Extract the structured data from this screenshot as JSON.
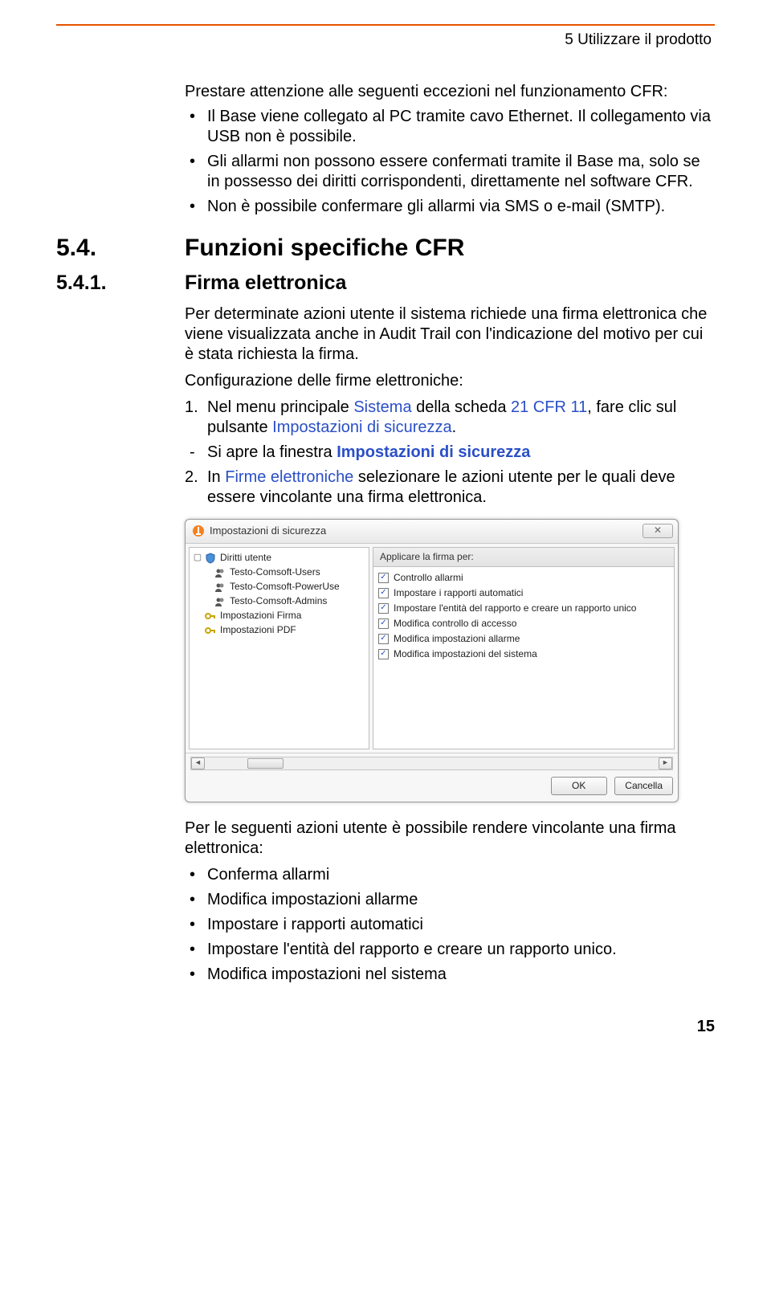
{
  "header": {
    "right": "5 Utilizzare il prodotto"
  },
  "intro": {
    "lead": "Prestare attenzione alle seguenti eccezioni nel funzionamento CFR:",
    "bullets": [
      "Il Base viene collegato al PC tramite cavo Ethernet. Il collegamento via USB non è possibile.",
      "Gli allarmi non possono essere confermati tramite il Base ma, solo se in possesso dei diritti corrispondenti, direttamente nel software CFR.",
      "Non è possibile confermare gli allarmi via SMS o e-mail (SMTP)."
    ]
  },
  "sec54": {
    "num": "5.4.",
    "title": "Funzioni specifiche CFR"
  },
  "sec541": {
    "num": "5.4.1.",
    "title": "Firma elettronica",
    "para1": "Per determinate azioni utente il sistema richiede una firma elettronica che viene visualizzata anche in Audit Trail con l'indicazione del motivo per cui è stata richiesta la firma.",
    "para2": "Configurazione delle firme elettroniche:",
    "step1_pre": "Nel menu principale ",
    "step1_sistema": "Sistema",
    "step1_mid": " della scheda ",
    "step1_cfr": "21 CFR 11",
    "step1_mid2": ", fare clic sul pulsante ",
    "step1_imp": "Impostazioni di sicurezza",
    "step1_end": ".",
    "dash_pre": "Si apre la finestra ",
    "dash_bold": "Impostazioni di sicurezza",
    "step2_pre": "In ",
    "step2_bold": "Firme elettroniche",
    "step2_rest": " selezionare le azioni utente per le quali deve essere vincolante una firma elettronica."
  },
  "dialog": {
    "title": "Impostazioni di sicurezza",
    "close": "✕",
    "tree": {
      "root": "Diritti utente",
      "children": [
        "Testo-Comsoft-Users",
        "Testo-Comsoft-PowerUse",
        "Testo-Comsoft-Admins"
      ],
      "extra": [
        "Impostazioni Firma",
        "Impostazioni PDF"
      ]
    },
    "right_header": "Applicare la firma per:",
    "checks": [
      "Controllo allarmi",
      "Impostare i rapporti automatici",
      "Impostare l'entità del rapporto e creare un rapporto unico",
      "Modifica controllo di accesso",
      "Modifica impostazioni allarme",
      "Modifica impostazioni del sistema"
    ],
    "ok": "OK",
    "cancel": "Cancella"
  },
  "after": {
    "lead": "Per le seguenti azioni utente è possibile rendere vincolante una firma elettronica:",
    "bullets": [
      "Conferma allarmi",
      "Modifica impostazioni allarme",
      "Impostare i rapporti automatici",
      "Impostare l'entità del rapporto e creare un rapporto unico.",
      "Modifica impostazioni nel sistema"
    ]
  },
  "pagenum": "15"
}
